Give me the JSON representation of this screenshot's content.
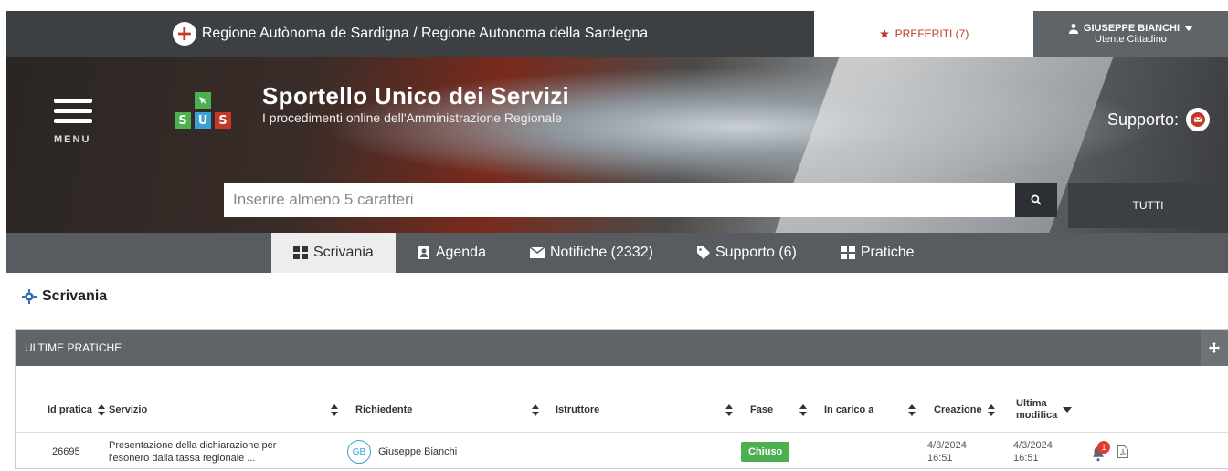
{
  "topbar": {
    "region": "Regione Autònoma de Sardigna / Regione Autonoma della Sardegna",
    "favorites": "PREFERITI (7)",
    "user_name": "GIUSEPPE BIANCHI",
    "user_role": "Utente Cittadino"
  },
  "header": {
    "menu_label": "MENU",
    "logo_letters": [
      "S",
      "U",
      "S"
    ],
    "title": "Sportello Unico dei Servizi",
    "subtitle": "I procedimenti online dell'Amministrazione Regionale",
    "support_label": "Supporto:"
  },
  "search": {
    "placeholder": "Inserire almeno 5 caratteri",
    "scope": "TUTTI"
  },
  "tabs": [
    {
      "label": "Scrivania",
      "icon": "dashboard-icon",
      "active": true
    },
    {
      "label": "Agenda",
      "icon": "address-book-icon"
    },
    {
      "label": "Notifiche (2332)",
      "icon": "envelope-icon"
    },
    {
      "label": "Supporto (6)",
      "icon": "tag-icon"
    },
    {
      "label": "Pratiche",
      "icon": "grid-icon"
    }
  ],
  "page": {
    "title": "Scrivania"
  },
  "panel": {
    "title": "ULTIME PRATICHE",
    "columns": [
      "Id pratica",
      "Servizio",
      "Richiedente",
      "Istruttore",
      "Fase",
      "In carico a",
      "Creazione",
      "Ultima modifica"
    ],
    "rows": [
      {
        "id": "26695",
        "servizio_1": "Presentazione della dichiarazione per",
        "servizio_2": "l'esonero dalla tassa regionale ...",
        "avatar": "GB",
        "richiedente": "Giuseppe Bianchi",
        "fase": "Chiuso",
        "creazione_date": "4/3/2024",
        "creazione_time": "16:51",
        "modifica_date": "4/3/2024",
        "modifica_time": "16:51",
        "notifications": "1"
      }
    ]
  },
  "colors": {
    "accent_red": "#c0392b",
    "status_green": "#4caf50",
    "link_blue": "#3aa0d8"
  }
}
